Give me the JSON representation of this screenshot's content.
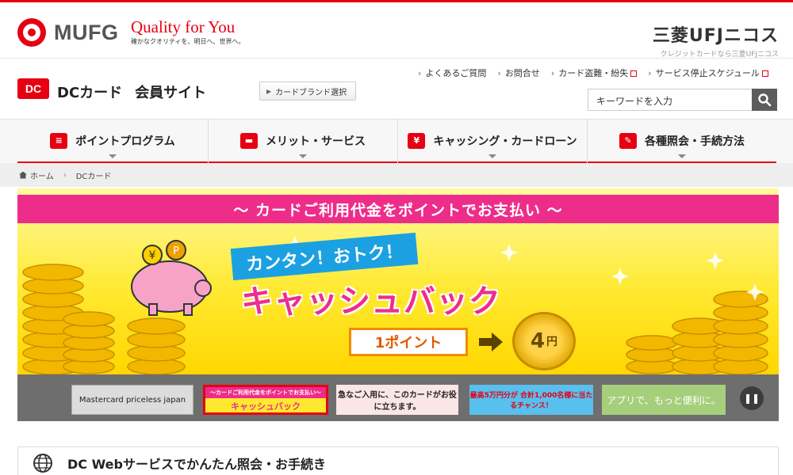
{
  "top": {
    "mufg": "MUFG",
    "quality_main": "Quality for You",
    "quality_sub": "確かなクオリティを、明日へ、世界へ。",
    "nicos_main": "三菱UFJニコス",
    "nicos_sub": "クレジットカードなら三菱UFJニコス"
  },
  "header": {
    "logo": "DC",
    "title_card": "DCカード",
    "title_site": "会員サイト",
    "brand_button": "カードブランド選択",
    "utility_links": [
      "よくあるご質問",
      "お問合せ",
      "カード盗難・紛失",
      "サービス停止スケジュール"
    ],
    "search_placeholder": "キーワードを入力"
  },
  "nav": {
    "items": [
      {
        "label": "ポイントプログラム",
        "icon": "coin-stack-icon"
      },
      {
        "label": "メリット・サービス",
        "icon": "card-icon"
      },
      {
        "label": "キャッシング・カードローン",
        "icon": "yen-card-icon"
      },
      {
        "label": "各種照会・手続方法",
        "icon": "edit-icon"
      }
    ]
  },
  "breadcrumb": {
    "home": "ホーム",
    "current": "DCカード"
  },
  "banner": {
    "band": "〜 カードご利用代金をポイントでお支払い 〜",
    "catch1": "カンタン！おトク！",
    "catch2": "キャッシュバック",
    "points": "1ポイント",
    "yen_value": "4",
    "yen_unit": "円"
  },
  "carousel": {
    "items": [
      "Mastercard priceless japan",
      "〜カードご利用代金をポイントでお支払い〜",
      "キャッシュバック",
      "急なご入用に、このカードがお役に立ちます。",
      "最高5万円分が 合計1,000名様に当たるチャンス！",
      "アプリで、もっと便利に。"
    ]
  },
  "section": {
    "title": "DC Webサービスでかんたん照会・お手続き"
  }
}
